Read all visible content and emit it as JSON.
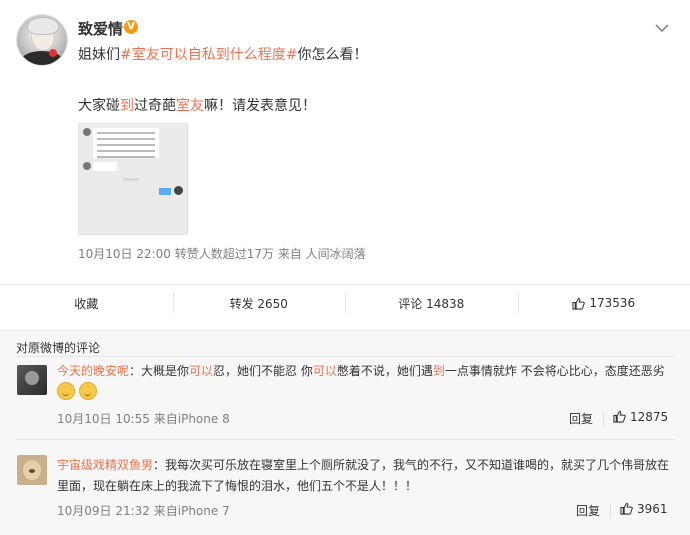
{
  "post": {
    "username": "致爱情",
    "verified_badge": "V",
    "text_line1": {
      "prefix": "姐妹们",
      "topic": "#室友可以自私到什么程度#",
      "suffix": "你怎么看！"
    },
    "text_line2": {
      "part1": "大家碰",
      "highlight1": "到",
      "part2": "过奇葩",
      "highlight2": "室友",
      "part3": "嘛！请发表意见！"
    },
    "meta": "10月10日 22:00 转赞人数超过17万  来自 人间冰阔落",
    "thumbnail_icon": "chat-screenshot-thumbnail"
  },
  "actions": {
    "favorite": "收藏",
    "repost": "转发 2650",
    "comment": "评论 14838",
    "like": "173536"
  },
  "comments_section": {
    "title": "对原微博的评论",
    "comments": [
      {
        "name": "今天的晚安呢",
        "t1": "：大概是你",
        "h1": "可以",
        "t2": "忍，她们不能忍 你",
        "h2": "可以",
        "t3": "憋着不说，她们遇",
        "h3": "到",
        "t4": "一点事情就炸 不会将心比心，态度还恶劣",
        "meta": "10月10日 10:55 来自iPhone 8",
        "reply": "回复",
        "likes": "12875"
      },
      {
        "name": "宇宙级戏精双鱼男",
        "text_line1": "：我每次买可乐放在寝室里上个厕所就没了，我气的不行，又不知道谁喝的，就买了几个伟哥放在",
        "text_line2": "里面，现在躺在床上的我流下了悔恨的泪水，他们五个不是人！！！",
        "meta": "10月09日 21:32 来自iPhone 7",
        "reply": "回复",
        "likes": "3961"
      }
    ]
  },
  "colors": {
    "accent": "#eb7350",
    "meta_gray": "#808080",
    "comment_bg": "#f7f7f7"
  }
}
